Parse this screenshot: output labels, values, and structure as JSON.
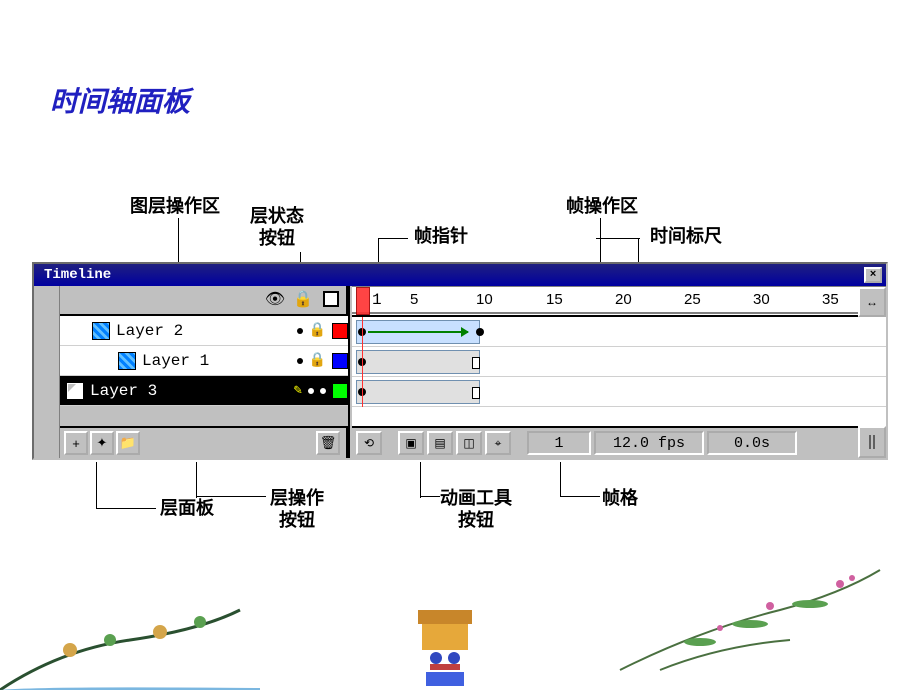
{
  "slide": {
    "title": "时间轴面板"
  },
  "annotations": {
    "layer_ops_area": "图层操作区",
    "layer_status_btns": "层状态\n按钮",
    "frame_ops_area": "帧操作区",
    "playhead": "帧指针",
    "time_ruler": "时间标尺",
    "layer_panel": "层面板",
    "layer_ops_btns": "层操作\n按钮",
    "anim_tool_btns": "动画工具\n按钮",
    "frame_cells": "帧格"
  },
  "window": {
    "title": "Timeline",
    "close": "×"
  },
  "ruler": {
    "ticks": [
      "5",
      "10",
      "15",
      "20",
      "25",
      "30",
      "35"
    ]
  },
  "layers": [
    {
      "name": "Layer 2",
      "indent": 1,
      "icon": "blue-ck",
      "locked": true,
      "swatch": "sw-red",
      "selected": false
    },
    {
      "name": "Layer 1",
      "indent": 2,
      "icon": "blue-ck",
      "locked": true,
      "swatch": "sw-blue",
      "selected": false
    },
    {
      "name": "Layer 3",
      "indent": 0,
      "icon": "white",
      "locked": false,
      "editing": true,
      "swatch": "sw-green",
      "selected": true
    }
  ],
  "status": {
    "frame": "1",
    "fps": "12.0 fps",
    "time": "0.0s"
  },
  "icons": {
    "eye": "👁",
    "lock": "🔒",
    "trash": "🗑",
    "new_layer": "+",
    "guide": "✦",
    "folder": "📁",
    "rewind": "⟲",
    "onion1": "▣",
    "onion2": "▤",
    "onion3": "◫",
    "center": "⌖",
    "expand": "↔"
  }
}
